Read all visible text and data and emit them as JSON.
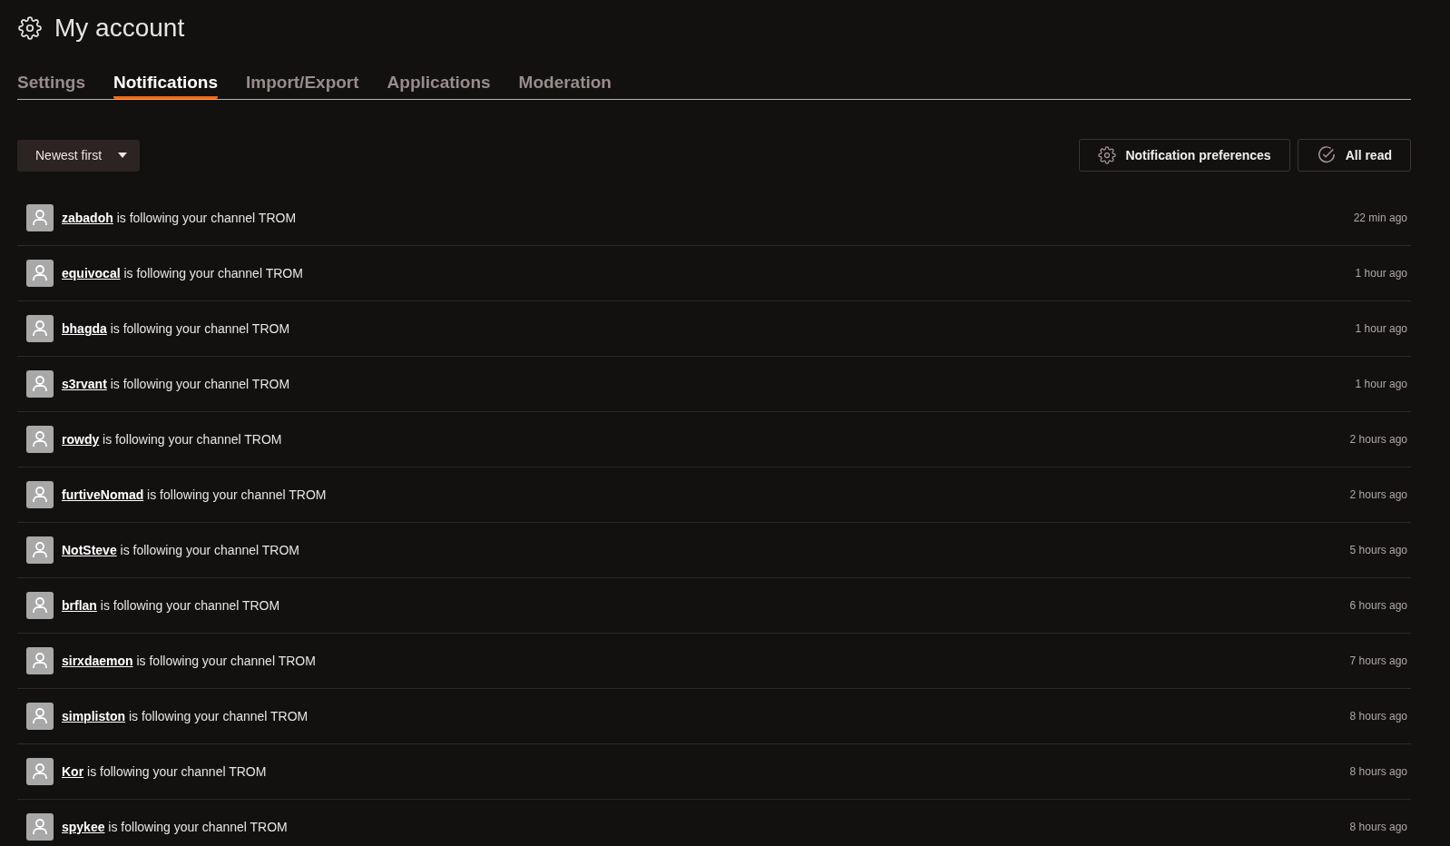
{
  "header": {
    "title": "My account"
  },
  "tabs": [
    {
      "label": "Settings",
      "selected": false
    },
    {
      "label": "Notifications",
      "selected": true
    },
    {
      "label": "Import/Export",
      "selected": false
    },
    {
      "label": "Applications",
      "selected": false
    },
    {
      "label": "Moderation",
      "selected": false
    }
  ],
  "sort": {
    "value": "Newest first"
  },
  "actions": {
    "preferences": "Notification preferences",
    "all_read": "All read"
  },
  "notifications": [
    {
      "user": "zabadoh",
      "text": "is following your channel TROM",
      "time": "22 min ago"
    },
    {
      "user": "equivocal",
      "text": "is following your channel TROM",
      "time": "1 hour ago"
    },
    {
      "user": "bhagda",
      "text": "is following your channel TROM",
      "time": "1 hour ago"
    },
    {
      "user": "s3rvant",
      "text": "is following your channel TROM",
      "time": "1 hour ago"
    },
    {
      "user": "rowdy",
      "text": "is following your channel TROM",
      "time": "2 hours ago"
    },
    {
      "user": "furtiveNomad",
      "text": "is following your channel TROM",
      "time": "2 hours ago"
    },
    {
      "user": "NotSteve",
      "text": "is following your channel TROM",
      "time": "5 hours ago"
    },
    {
      "user": "brflan",
      "text": "is following your channel TROM",
      "time": "6 hours ago"
    },
    {
      "user": "sirxdaemon",
      "text": "is following your channel TROM",
      "time": "7 hours ago"
    },
    {
      "user": "simpliston",
      "text": "is following your channel TROM",
      "time": "8 hours ago"
    },
    {
      "user": "Kor",
      "text": "is following your channel TROM",
      "time": "8 hours ago"
    },
    {
      "user": "spykee",
      "text": "is following your channel TROM",
      "time": "8 hours ago"
    }
  ]
}
